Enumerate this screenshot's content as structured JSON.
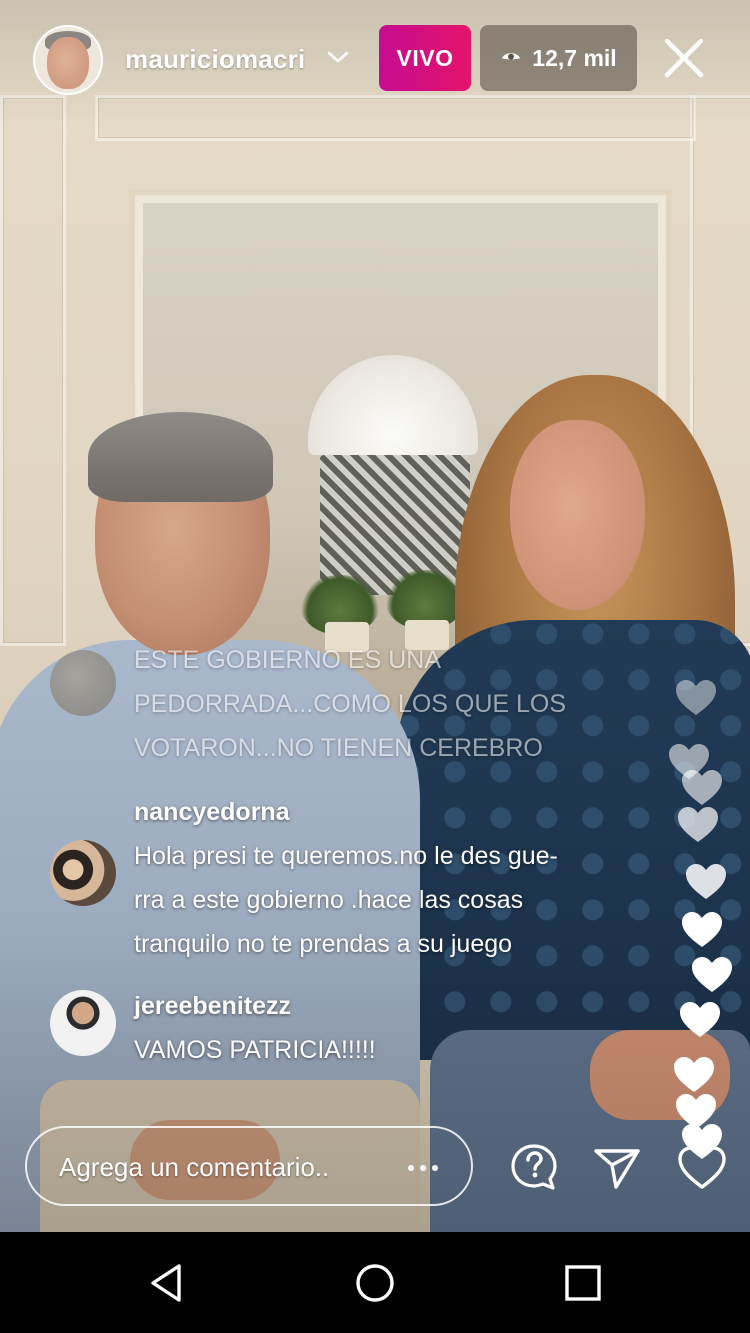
{
  "host": {
    "username": "mauriciomacri",
    "live_label": "VIVO",
    "viewer_count": "12,7 mil"
  },
  "comments": [
    {
      "user": "",
      "lines": [
        "ESTE GOBIERNO ES UNA",
        "PEDORRADA...COMO LOS QUE LOS",
        "VOTARON...NO TIENEN CEREBRO"
      ]
    },
    {
      "user": "nancyedorna",
      "lines": [
        "Hola presi te queremos.no le des gue-",
        "rra a este gobierno .hace las cosas",
        "tranquilo no te prendas a su juego"
      ]
    },
    {
      "user": "jereebenitezz",
      "lines": [
        "VAMOS PATRICIA!!!!!"
      ]
    }
  ],
  "comment_bar": {
    "placeholder": "Agrega un comentario.."
  },
  "icons": {
    "chevron": "chevron-down-icon",
    "eye": "eye-icon",
    "close": "close-icon",
    "more": "more-options-icon",
    "question": "question-icon",
    "share": "send-icon",
    "like": "heart-icon",
    "nav_back": "back-triangle-icon",
    "nav_home": "home-circle-icon",
    "nav_recents": "recents-square-icon"
  },
  "colors": {
    "live_gradient_start": "#c50c92",
    "live_gradient_end": "#e5136a",
    "text": "#ffffff",
    "navbar": "#000000"
  }
}
